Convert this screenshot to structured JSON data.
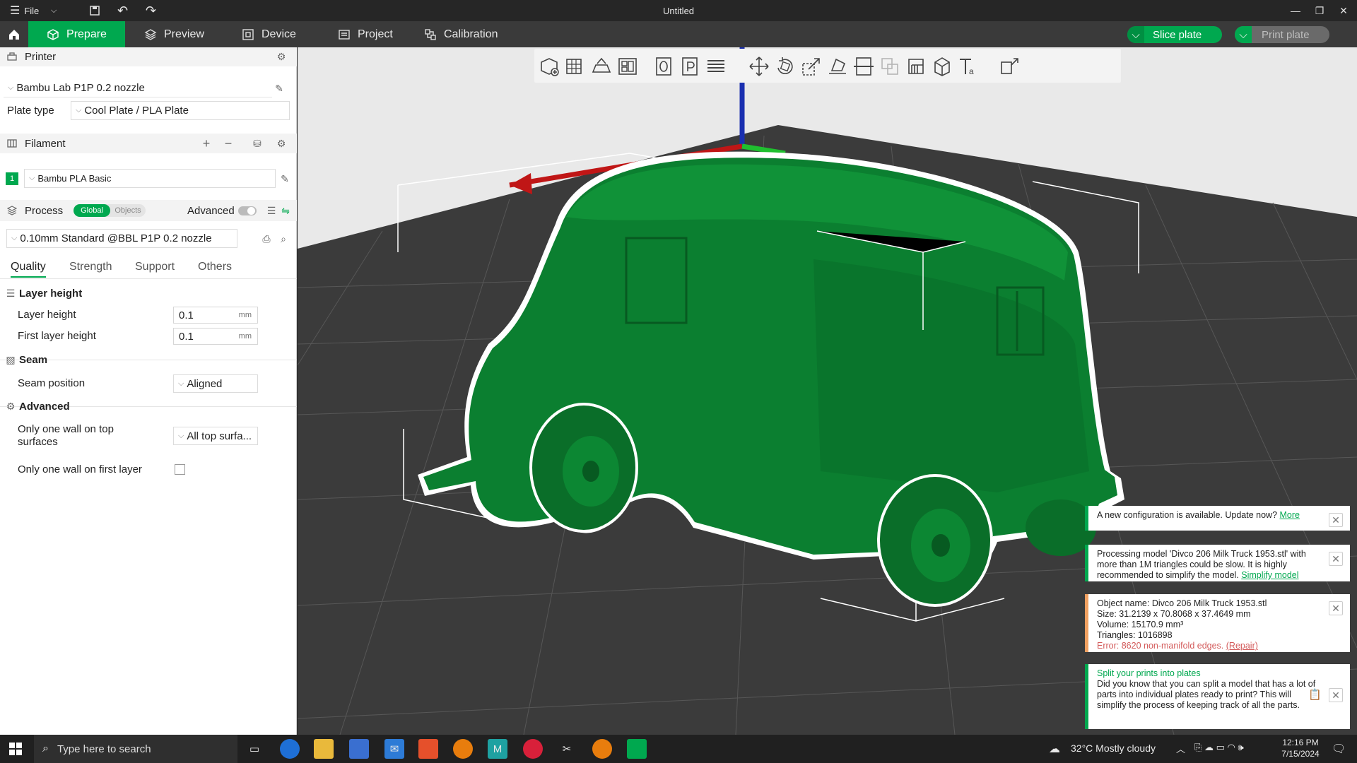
{
  "titlebar": {
    "menu_label": "File",
    "title": "Untitled"
  },
  "tabs": {
    "prepare": "Prepare",
    "preview": "Preview",
    "device": "Device",
    "project": "Project",
    "calibration": "Calibration",
    "slice_plate": "Slice plate",
    "print_plate": "Print plate"
  },
  "printer": {
    "section_label": "Printer",
    "selected": "Bambu Lab P1P 0.2 nozzle",
    "plate_type_label": "Plate type",
    "plate_type": "Cool Plate / PLA Plate"
  },
  "filament": {
    "section_label": "Filament",
    "slot_number": "1",
    "selected": "Bambu PLA Basic",
    "slot_color": "#00a84f"
  },
  "process": {
    "section_label": "Process",
    "toggle_global": "Global",
    "toggle_objects": "Objects",
    "advanced_label": "Advanced",
    "preset": "0.10mm Standard @BBL P1P 0.2 nozzle",
    "subtabs": [
      "Quality",
      "Strength",
      "Support",
      "Others"
    ],
    "groups": {
      "layer_height": {
        "title": "Layer height",
        "layer_height_label": "Layer height",
        "layer_height_value": "0.1",
        "first_layer_label": "First layer height",
        "first_layer_value": "0.1",
        "unit": "mm"
      },
      "seam": {
        "title": "Seam",
        "seam_position_label": "Seam position",
        "seam_position_value": "Aligned"
      },
      "advanced": {
        "title": "Advanced",
        "one_wall_top_label": "Only one wall on top surfaces",
        "one_wall_top_value": "All top surfa...",
        "one_wall_first_label": "Only one wall on first layer"
      }
    }
  },
  "notifications": {
    "config_update": {
      "text": "A new configuration is available. Update now?",
      "link": "More"
    },
    "processing": {
      "text": "Processing model 'Divco 206 Milk Truck 1953.stl' with more than 1M triangles could be slow. It is highly recommended to simplify the model.",
      "link": "Simplify model"
    },
    "object_info": {
      "name": "Object name: Divco 206 Milk Truck 1953.stl",
      "size": "Size: 31.2139 x 70.8068 x 37.4649 mm",
      "volume": "Volume: 15170.9 mm³",
      "triangles": "Triangles: 1016898",
      "error": "Error: 8620 non-manifold edges.",
      "repair": "(Repair)"
    },
    "tip": {
      "title": "Split your prints into plates",
      "body": "Did you know that you can split a model that has a lot of parts into individual plates ready to print? This will simplify the process of keeping track of all the parts."
    }
  },
  "taskbar": {
    "search_placeholder": "Type here to search",
    "weather": "32°C  Mostly cloudy",
    "time": "12:16 PM",
    "date": "7/15/2024"
  },
  "colors": {
    "accent": "#00a84f",
    "model": "#0a7a2e"
  }
}
